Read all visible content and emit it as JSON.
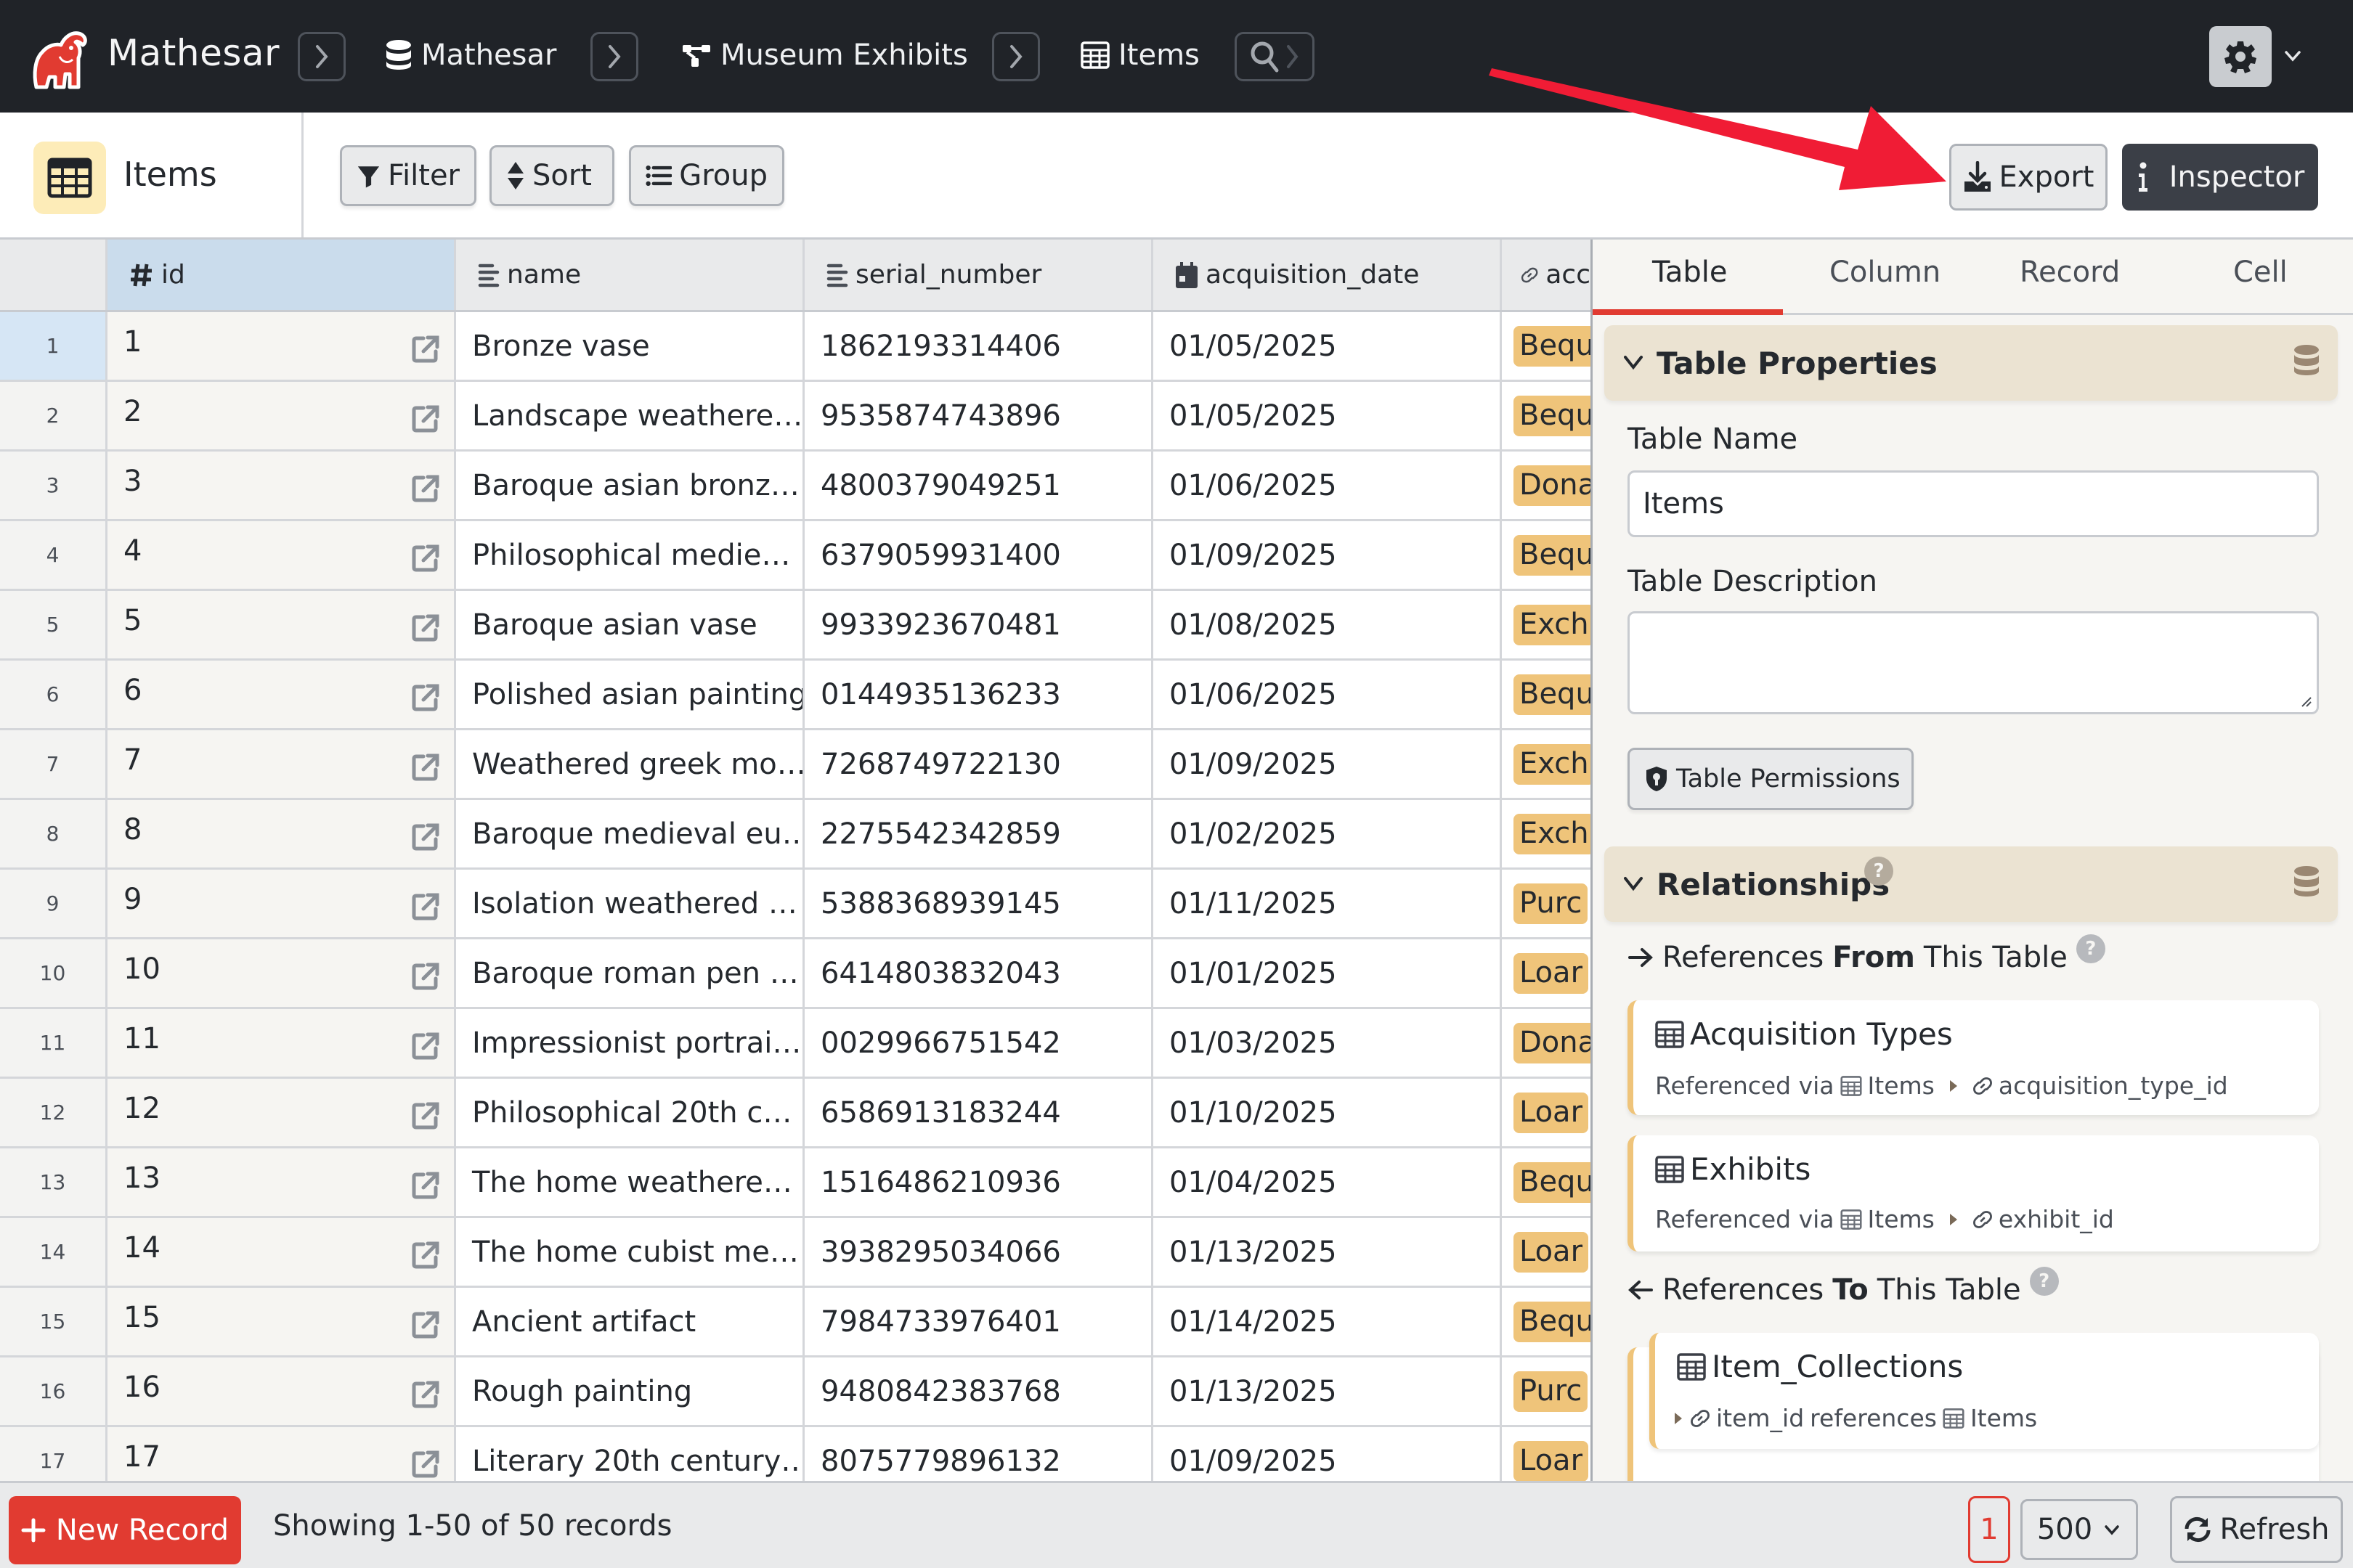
{
  "app": {
    "brand": "Mathesar",
    "brand_color": "#e13b31"
  },
  "breadcrumbs": [
    {
      "label": "Mathesar",
      "icon": "database-icon"
    },
    {
      "label": "Museum Exhibits",
      "icon": "schema-icon"
    },
    {
      "label": "Items",
      "icon": "table-icon"
    }
  ],
  "toolbar": {
    "table_title": "Items",
    "filter_label": "Filter",
    "sort_label": "Sort",
    "group_label": "Group",
    "export_label": "Export",
    "inspector_label": "Inspector"
  },
  "table": {
    "columns": [
      {
        "key": "id",
        "label": "id",
        "icon": "hash-icon"
      },
      {
        "key": "name",
        "label": "name",
        "icon": "text-icon"
      },
      {
        "key": "serial_number",
        "label": "serial_number",
        "icon": "text-icon"
      },
      {
        "key": "acquisition_date",
        "label": "acquisition_date",
        "icon": "calendar-icon"
      },
      {
        "key": "acquisition_type_id",
        "label": "acc",
        "icon": "link-icon"
      }
    ],
    "rows": [
      {
        "rownum": "1",
        "id": "1",
        "name": "Bronze vase",
        "serial_number": "1862193314406",
        "acquisition_date": "01/05/2025",
        "acquisition_type": "Bequ"
      },
      {
        "rownum": "2",
        "id": "2",
        "name": "Landscape weathere…",
        "serial_number": "9535874743896",
        "acquisition_date": "01/05/2025",
        "acquisition_type": "Bequ"
      },
      {
        "rownum": "3",
        "id": "3",
        "name": "Baroque asian bronz…",
        "serial_number": "4800379049251",
        "acquisition_date": "01/06/2025",
        "acquisition_type": "Dona"
      },
      {
        "rownum": "4",
        "id": "4",
        "name": "Philosophical medie…",
        "serial_number": "6379059931400",
        "acquisition_date": "01/09/2025",
        "acquisition_type": "Bequ"
      },
      {
        "rownum": "5",
        "id": "5",
        "name": "Baroque asian vase",
        "serial_number": "9933923670481",
        "acquisition_date": "01/08/2025",
        "acquisition_type": "Exch"
      },
      {
        "rownum": "6",
        "id": "6",
        "name": "Polished asian painting",
        "serial_number": "0144935136233",
        "acquisition_date": "01/06/2025",
        "acquisition_type": "Bequ"
      },
      {
        "rownum": "7",
        "id": "7",
        "name": "Weathered greek mo…",
        "serial_number": "7268749722130",
        "acquisition_date": "01/09/2025",
        "acquisition_type": "Exch"
      },
      {
        "rownum": "8",
        "id": "8",
        "name": "Baroque medieval eu…",
        "serial_number": "2275542342859",
        "acquisition_date": "01/02/2025",
        "acquisition_type": "Exch"
      },
      {
        "rownum": "9",
        "id": "9",
        "name": "Isolation weathered …",
        "serial_number": "5388368939145",
        "acquisition_date": "01/11/2025",
        "acquisition_type": "Purc"
      },
      {
        "rownum": "10",
        "id": "10",
        "name": "Baroque roman pen …",
        "serial_number": "6414803832043",
        "acquisition_date": "01/01/2025",
        "acquisition_type": "Loar"
      },
      {
        "rownum": "11",
        "id": "11",
        "name": "Impressionist portrai…",
        "serial_number": "0029966751542",
        "acquisition_date": "01/03/2025",
        "acquisition_type": "Dona"
      },
      {
        "rownum": "12",
        "id": "12",
        "name": "Philosophical 20th c…",
        "serial_number": "6586913183244",
        "acquisition_date": "01/10/2025",
        "acquisition_type": "Loar"
      },
      {
        "rownum": "13",
        "id": "13",
        "name": "The home weathere…",
        "serial_number": "1516486210936",
        "acquisition_date": "01/04/2025",
        "acquisition_type": "Bequ"
      },
      {
        "rownum": "14",
        "id": "14",
        "name": "The home cubist me…",
        "serial_number": "3938295034066",
        "acquisition_date": "01/13/2025",
        "acquisition_type": "Loar"
      },
      {
        "rownum": "15",
        "id": "15",
        "name": "Ancient artifact",
        "serial_number": "7984733976401",
        "acquisition_date": "01/14/2025",
        "acquisition_type": "Bequ"
      },
      {
        "rownum": "16",
        "id": "16",
        "name": "Rough painting",
        "serial_number": "9480842383768",
        "acquisition_date": "01/13/2025",
        "acquisition_type": "Purc"
      },
      {
        "rownum": "17",
        "id": "17",
        "name": "Literary 20th century…",
        "serial_number": "8075779896132",
        "acquisition_date": "01/09/2025",
        "acquisition_type": "Loar"
      }
    ]
  },
  "inspector": {
    "tabs": [
      {
        "label": "Table",
        "active": true
      },
      {
        "label": "Column",
        "active": false
      },
      {
        "label": "Record",
        "active": false
      },
      {
        "label": "Cell",
        "active": false
      }
    ],
    "table_properties": {
      "title": "Table Properties",
      "name_label": "Table Name",
      "name_value": "Items",
      "description_label": "Table Description",
      "description_value": "",
      "permissions_label": "Table Permissions"
    },
    "relationships": {
      "title": "Relationships",
      "help": "?",
      "from_prefix": "References",
      "from_bold": "From",
      "from_suffix": "This Table",
      "from_refs": [
        {
          "table": "Acquisition Types",
          "via_label": "Referenced via",
          "via_table": "Items",
          "via_column": "acquisition_type_id"
        },
        {
          "table": "Exhibits",
          "via_label": "Referenced via",
          "via_table": "Items",
          "via_column": "exhibit_id"
        }
      ],
      "to_prefix": "References",
      "to_bold": "To",
      "to_suffix": "This Table",
      "to_refs": [
        {
          "table": "Item_Collections",
          "column": "item_id",
          "references_label": "references",
          "target_table": "Items"
        }
      ]
    }
  },
  "footer": {
    "new_record_label": "New Record",
    "showing_text": "Showing 1-50 of 50 records",
    "current_page": "1",
    "page_size": "500",
    "refresh_label": "Refresh"
  }
}
